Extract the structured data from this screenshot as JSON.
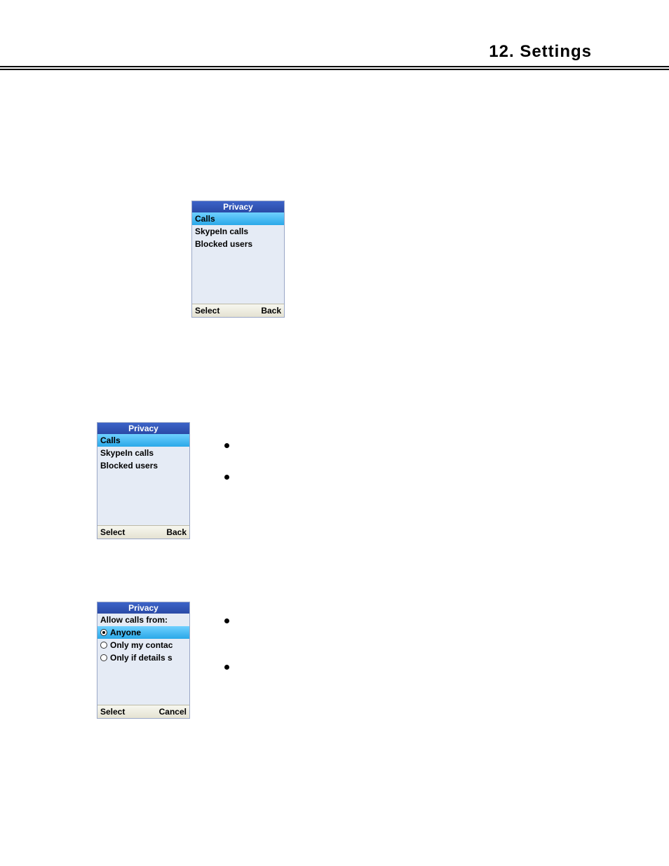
{
  "header": {
    "title": "12. Settings"
  },
  "phone1": {
    "title": "Privacy",
    "items": [
      "Calls",
      "SkypeIn calls",
      "Blocked users"
    ],
    "selectedIndex": 0,
    "softLeft": "Select",
    "softRight": "Back"
  },
  "phone2": {
    "title": "Privacy",
    "items": [
      "Calls",
      "SkypeIn calls",
      "Blocked users"
    ],
    "selectedIndex": 0,
    "softLeft": "Select",
    "softRight": "Back"
  },
  "phone3": {
    "title": "Privacy",
    "subhead": "Allow calls from:",
    "options": [
      "Anyone",
      "Only my contac",
      "Only if details s"
    ],
    "selectedIndex": 0,
    "softLeft": "Select",
    "softRight": "Cancel"
  }
}
